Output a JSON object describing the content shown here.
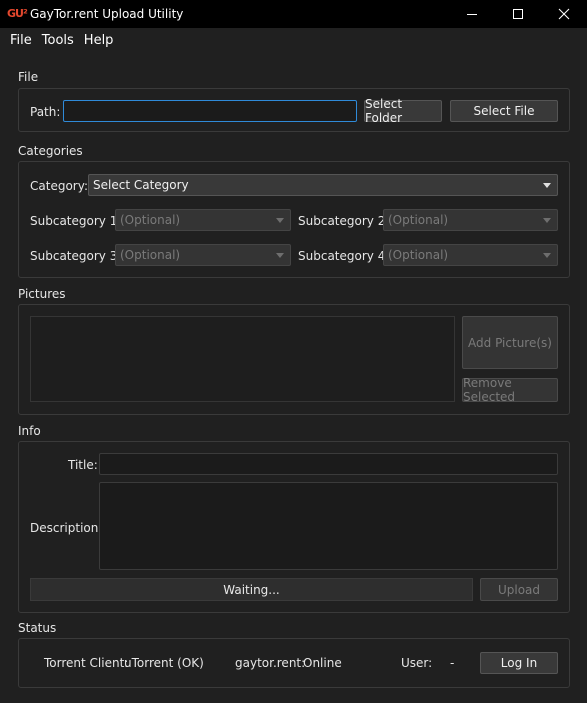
{
  "window": {
    "title": "GayTor.rent Upload Utility",
    "icon_text": "GU²"
  },
  "menu": [
    "File",
    "Tools",
    "Help"
  ],
  "file_section": {
    "label": "File",
    "path_label": "Path:",
    "path_value": "",
    "select_folder": "Select Folder",
    "select_file": "Select File"
  },
  "categories": {
    "label": "Categories",
    "category_label": "Category:",
    "category_value": "Select Category",
    "sub1_label": "Subcategory 1:",
    "sub2_label": "Subcategory 2:",
    "sub3_label": "Subcategory 3:",
    "sub4_label": "Subcategory 4:",
    "optional": "(Optional)"
  },
  "pictures": {
    "label": "Pictures",
    "add": "Add Picture(s)",
    "remove": "Remove Selected"
  },
  "info": {
    "label": "Info",
    "title_label": "Title:",
    "description_label": "Description:",
    "progress_text": "Waiting...",
    "upload": "Upload"
  },
  "status": {
    "label": "Status",
    "torrent_client_label": "Torrent Client:",
    "torrent_client_value": "uTorrent (OK)",
    "site_label": "gaytor.rent:",
    "site_value": "Online",
    "user_label": "User:",
    "user_value": "-",
    "login": "Log In"
  }
}
